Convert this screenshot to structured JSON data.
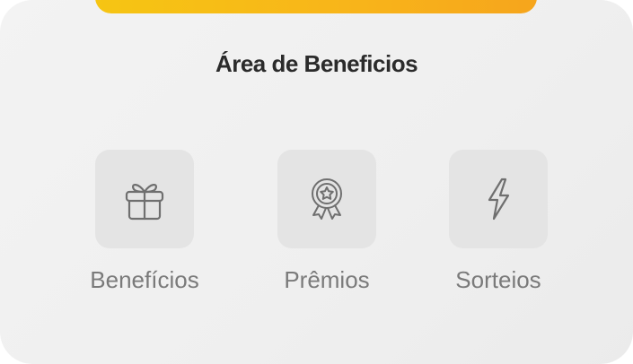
{
  "colors": {
    "accent_start": "#f6c513",
    "accent_end": "#f6a51c",
    "card_background": "#f0f0f0",
    "tile_background": "#e4e4e4",
    "title_text": "#2b2b2b",
    "label_text": "#7a7a7a",
    "icon_stroke": "#6f6f6f"
  },
  "card": {
    "title": "Área de Beneficios"
  },
  "menu": {
    "items": [
      {
        "label": "Benefícios",
        "icon": "gift-icon"
      },
      {
        "label": "Prêmios",
        "icon": "award-medal-icon"
      },
      {
        "label": "Sorteios",
        "icon": "lightning-bolt-icon"
      }
    ]
  }
}
